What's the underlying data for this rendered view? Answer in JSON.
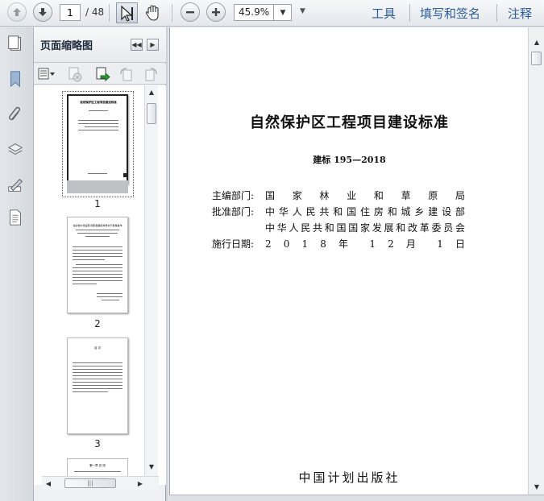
{
  "toolbar": {
    "page_current": "1",
    "page_total": "/ 48",
    "zoom": "45.9%",
    "tabs": [
      "工具",
      "填写和签名",
      "注释"
    ]
  },
  "thumbnail_panel": {
    "title": "页面缩略图",
    "pages": [
      {
        "label": "1",
        "heading": "自然保护区工程项目建设标准"
      },
      {
        "label": "2",
        "heading": "住房城乡建设部 国家发展改革委关于批准发布"
      },
      {
        "label": "3",
        "heading": "目 次"
      },
      {
        "label": "",
        "heading": "第一章 总 则"
      }
    ]
  },
  "document": {
    "title": "自然保护区工程项目建设标准",
    "code": "建标 195—2018",
    "rows": [
      {
        "label": "主编部门:",
        "value": "国 家 林 业 和 草 原 局"
      },
      {
        "label": "批准部门:",
        "value": "中华人民共和国住房和城乡建设部"
      },
      {
        "label": "",
        "value": "中华人民共和国国家发展和改革委员会"
      },
      {
        "label": "施行日期:",
        "value": "2 0 1 8 年 1 2 月 1 日"
      }
    ],
    "publisher": "中国计划出版社"
  },
  "icons": {
    "prev_page": "arrow-up-icon",
    "next_page": "arrow-down-icon",
    "select": "cursor-icon",
    "hand": "hand-icon",
    "zoom_out": "minus-icon",
    "zoom_in": "plus-icon"
  },
  "colors": {
    "tab_text": "#2d5e9e"
  }
}
